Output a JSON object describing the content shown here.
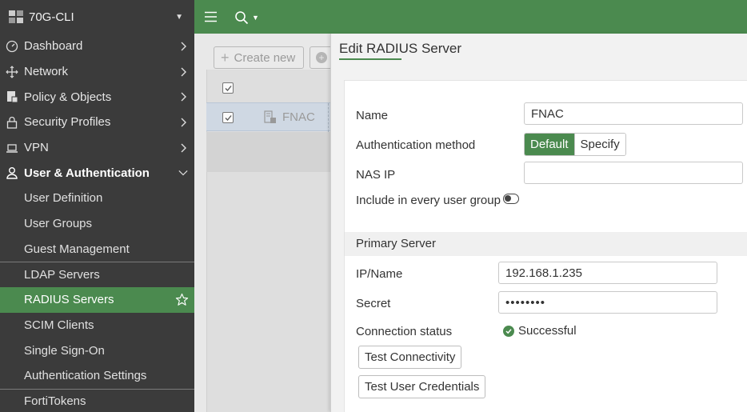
{
  "app": {
    "device_name": "70G-CLI"
  },
  "sidebar": {
    "items": [
      {
        "label": "Dashboard",
        "icon": "dashboard-icon"
      },
      {
        "label": "Network",
        "icon": "network-icon"
      },
      {
        "label": "Policy & Objects",
        "icon": "policy-icon"
      },
      {
        "label": "Security Profiles",
        "icon": "lock-icon"
      },
      {
        "label": "VPN",
        "icon": "laptop-icon"
      }
    ],
    "section": {
      "label": "User & Authentication",
      "icon": "user-icon"
    },
    "subitems": [
      "User Definition",
      "User Groups",
      "Guest Management",
      "LDAP Servers",
      "RADIUS Servers",
      "SCIM Clients",
      "Single Sign-On",
      "Authentication Settings",
      "FortiTokens"
    ],
    "active_subitem": "RADIUS Servers"
  },
  "list": {
    "create_new_label": "Create new",
    "row_name": "FNAC"
  },
  "editor": {
    "title": "Edit RADIUS Server",
    "name_label": "Name",
    "name_value": "FNAC",
    "auth_method_label": "Authentication method",
    "auth_default": "Default",
    "auth_specify": "Specify",
    "nas_ip_label": "NAS IP",
    "nas_ip_value": "",
    "include_label": "Include in every user group",
    "primary_section": "Primary Server",
    "ip_label": "IP/Name",
    "ip_value": "192.168.1.235",
    "secret_label": "Secret",
    "secret_value": "••••••••",
    "conn_status_label": "Connection status",
    "conn_status_value": "Successful",
    "test_connectivity": "Test Connectivity",
    "test_credentials": "Test User Credentials"
  },
  "colors": {
    "accent": "#4b8a4f",
    "sidebar_bg": "#3b3b3b"
  }
}
